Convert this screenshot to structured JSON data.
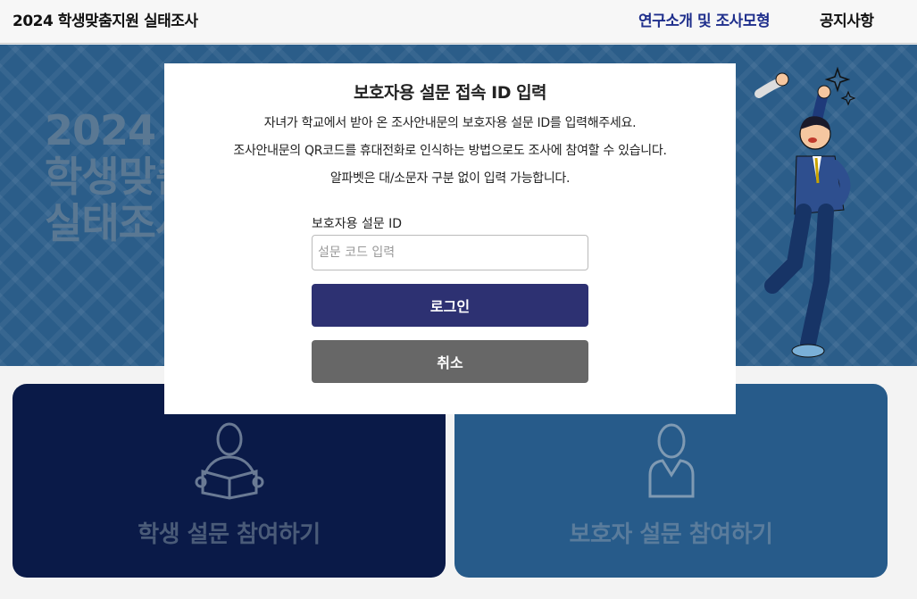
{
  "header": {
    "brand": "2024 학생맞춤지원 실태조사",
    "nav": [
      "연구소개 및 조사모형",
      "공지사항"
    ]
  },
  "hero": {
    "title_lines": [
      "2024",
      "학생맞춤",
      "실태조사"
    ]
  },
  "cards": {
    "student_label": "학생 설문 참여하기",
    "parent_label": "보호자 설문 참여하기"
  },
  "modal": {
    "title": "보호자용 설문 접속 ID 입력",
    "desc1": "자녀가 학교에서 받아 온 조사안내문의 보호자용 설문 ID를 입력해주세요.",
    "desc2": "조사안내문의 QR코드를 휴대전화로 인식하는 방법으로도 조사에 참여할 수 있습니다.",
    "desc3": "알파벳은 대/소문자 구분 없이 입력 가능합니다.",
    "field_label": "보호자용 설문 ID",
    "field_placeholder": "설문 코드 입력",
    "field_value": "",
    "login_label": "로그인",
    "cancel_label": "취소"
  },
  "colors": {
    "nav_active": "#1f2f8c",
    "hero_bg": "#2b5d89",
    "student_card": "#0a1a48",
    "parent_card": "#275b8a",
    "login_button": "#2d3172",
    "cancel_button": "#676767"
  },
  "icons": {
    "student": "person-reading-book-icon",
    "parent": "person-bust-icon"
  }
}
